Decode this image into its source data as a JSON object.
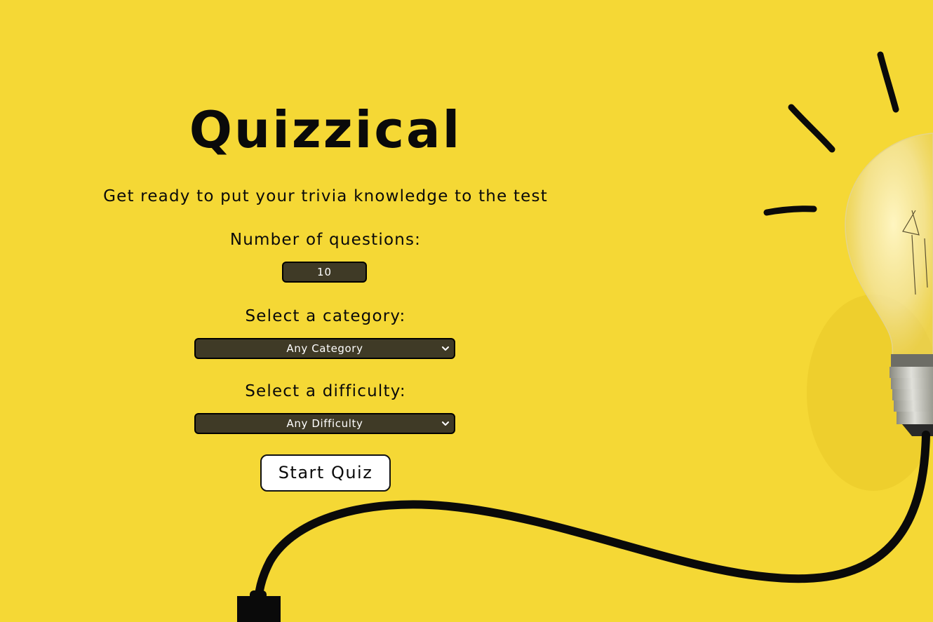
{
  "app": {
    "title": "Quizzical",
    "subtitle": "Get ready to put your trivia knowledge to the test"
  },
  "form": {
    "questions_label": "Number of questions:",
    "questions_value": "10",
    "category_label": "Select a category:",
    "category_value": "Any Category",
    "difficulty_label": "Select a difficulty:",
    "difficulty_value": "Any Difficulty",
    "start_label": "Start Quiz"
  },
  "colors": {
    "background": "#f5d835",
    "control_bg": "#3f3a26",
    "text": "#0a0a0a"
  },
  "icons": {
    "select_arrow": "chevron-down-icon",
    "illustration": "lightbulb-icon"
  }
}
